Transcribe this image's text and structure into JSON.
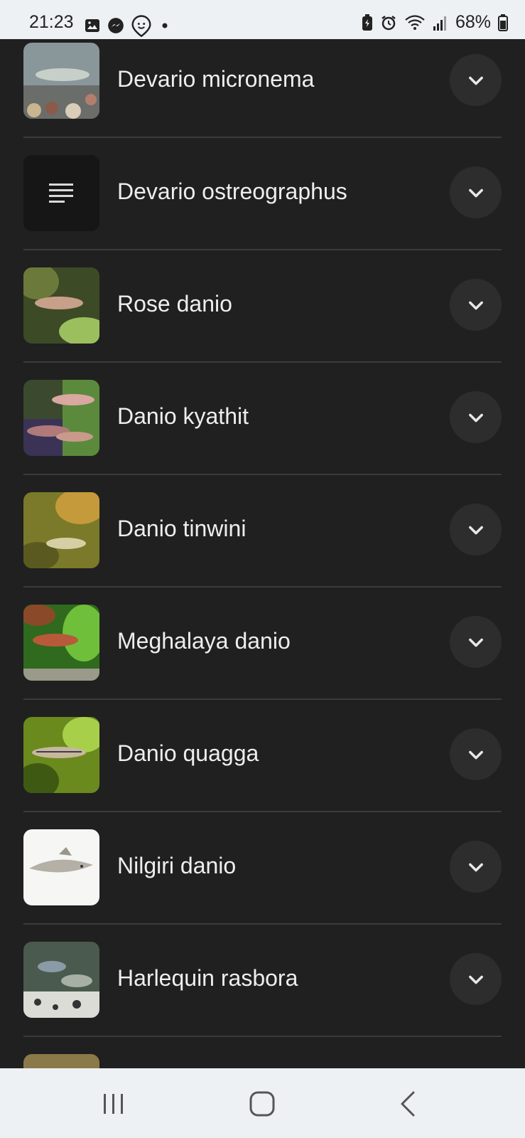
{
  "status_bar": {
    "time": "21:23",
    "battery": "68%",
    "left_icons": [
      "gallery-icon",
      "messenger-icon",
      "app-face-icon",
      "dot-icon"
    ],
    "right_icons": [
      "battery-saver-icon",
      "alarm-icon",
      "wifi-icon",
      "signal-icon",
      "battery-icon"
    ]
  },
  "species": [
    {
      "name": "Devario micronema",
      "thumb": "photo"
    },
    {
      "name": "Devario ostreographus",
      "thumb": "placeholder"
    },
    {
      "name": "Rose danio",
      "thumb": "photo"
    },
    {
      "name": "Danio kyathit",
      "thumb": "photo"
    },
    {
      "name": "Danio tinwini",
      "thumb": "photo"
    },
    {
      "name": "Meghalaya danio",
      "thumb": "photo"
    },
    {
      "name": "Danio quagga",
      "thumb": "photo"
    },
    {
      "name": "Nilgiri danio",
      "thumb": "photo"
    },
    {
      "name": "Harlequin rasbora",
      "thumb": "photo"
    }
  ],
  "nav_bar": {
    "buttons": [
      "recent-apps-icon",
      "home-icon",
      "back-icon"
    ]
  },
  "colors": {
    "background": "#202020",
    "divider": "#3b3b3b",
    "button": "#2d2d2d",
    "text": "#eeeeee",
    "system_bar": "#eef1f3"
  }
}
